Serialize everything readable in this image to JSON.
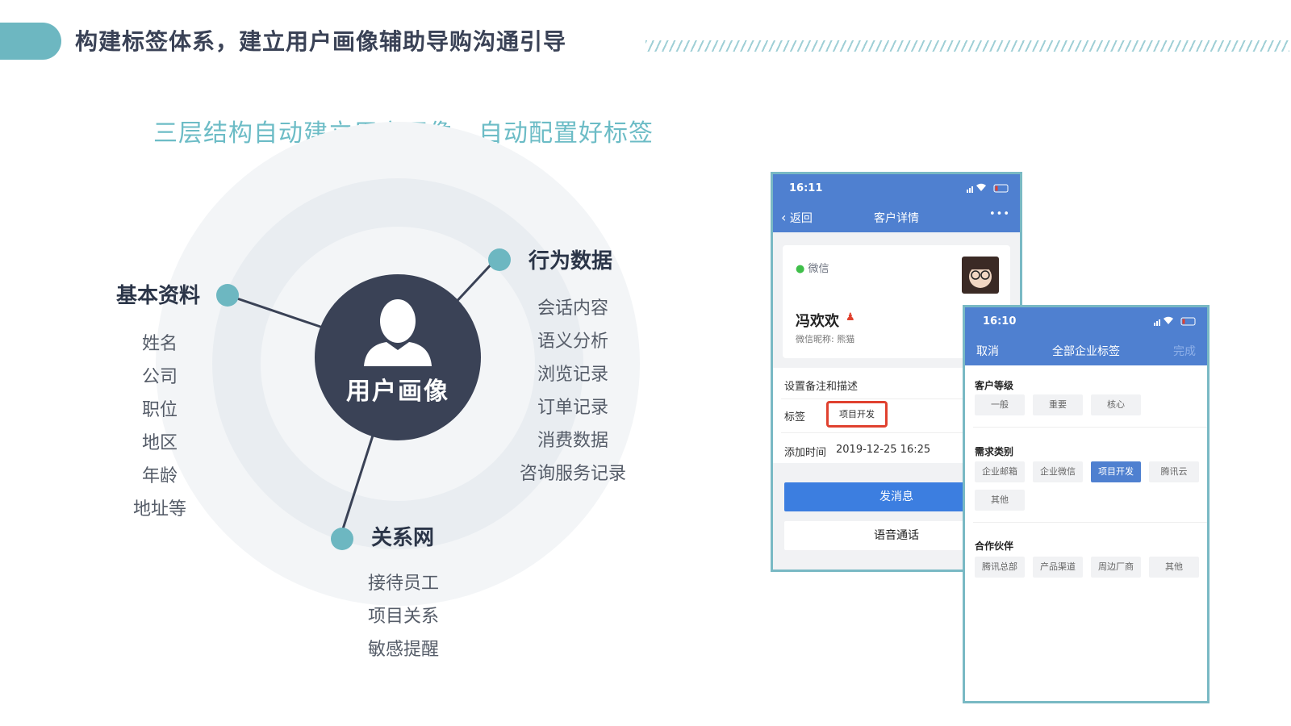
{
  "header": {
    "title": "构建标签体系，建立用户画像辅助导购沟通引导"
  },
  "subtitle": "三层结构自动建立用户画像，自动配置好标签",
  "diagram": {
    "center": "用户画像",
    "basic": {
      "title": "基本资料",
      "items": [
        "姓名",
        "公司",
        "职位",
        "地区",
        "年龄",
        "地址等"
      ]
    },
    "behavior": {
      "title": "行为数据",
      "items": [
        "会话内容",
        "语义分析",
        "浏览记录",
        "订单记录",
        "消费数据",
        "咨询服务记录"
      ]
    },
    "relation": {
      "title": "关系网",
      "items": [
        "接待员工",
        "项目关系",
        "敏感提醒"
      ]
    }
  },
  "phone1": {
    "time": "16:11",
    "back": "返回",
    "title": "客户详情",
    "more": "•••",
    "wechat": "微信",
    "name": "冯欢欢",
    "nickname": "微信昵称: 熊猫",
    "remark_label": "设置备注和描述",
    "tag_label": "标签",
    "tag_value": "项目开发",
    "time_label": "添加时间",
    "time_value": "2019-12-25 16:25",
    "send_button": "发消息",
    "voice_button": "语音通话"
  },
  "phone2": {
    "time": "16:10",
    "cancel": "取消",
    "title": "全部企业标签",
    "done": "完成",
    "groups": [
      {
        "title": "客户等级",
        "tags": [
          "一般",
          "重要",
          "核心"
        ]
      },
      {
        "title": "需求类别",
        "tags": [
          "企业邮箱",
          "企业微信",
          "项目开发",
          "腾讯云",
          "其他"
        ],
        "active": "项目开发"
      },
      {
        "title": "合作伙伴",
        "tags": [
          "腾讯总部",
          "产品渠道",
          "周边厂商",
          "其他"
        ]
      }
    ]
  },
  "colors": {
    "teal": "#6db7c1",
    "navy": "#3a4256",
    "blue": "#4f80d0",
    "red": "#e0412f"
  }
}
